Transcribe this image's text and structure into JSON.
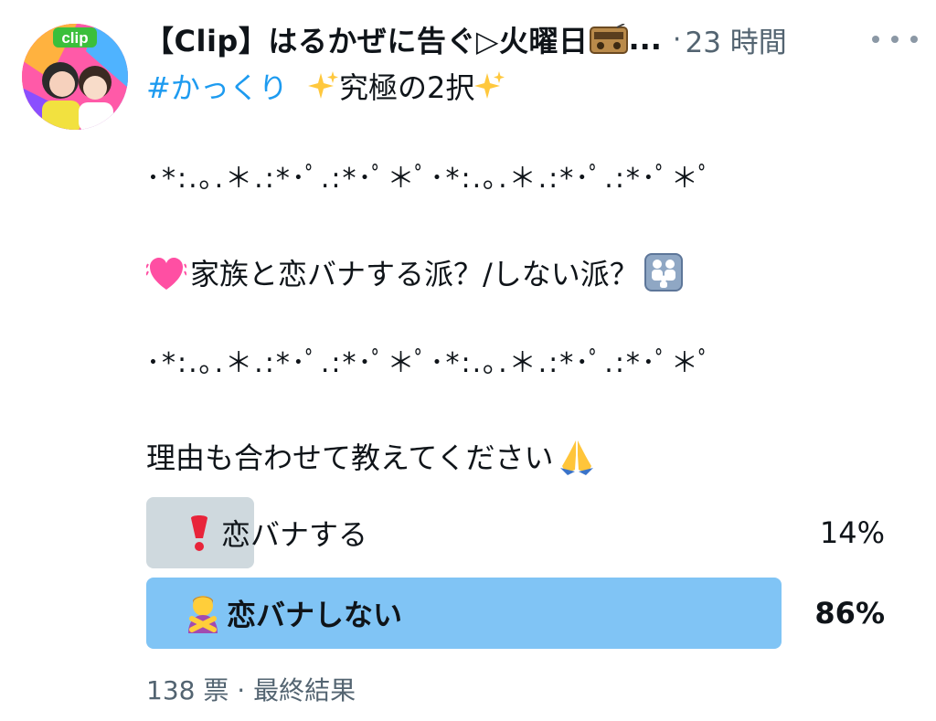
{
  "header": {
    "display_name": "【Clip】はるかぜに告ぐ▷火曜日",
    "radio_icon": "radio-icon",
    "ellipsis": "...",
    "separator": "·",
    "time": "23 時間",
    "more_icon": "more-icon"
  },
  "avatar": {
    "badge": "clip"
  },
  "body": {
    "hashtag": "#かっくり",
    "line1_text": "究極の2択",
    "divider1": "･*:.｡.＊.:*･ﾟ.:*･ﾟ＊ﾟ･*:.｡.＊.:*･ﾟ.:*･ﾟ＊ﾟ",
    "question": "家族と恋バナする派？/しない派？",
    "divider2": "･*:.｡.＊.:*･ﾟ.:*･ﾟ＊ﾟ･*:.｡.＊.:*･ﾟ.:*･ﾟ＊ﾟ",
    "request": "理由も合わせて教えてください"
  },
  "poll": {
    "options": [
      {
        "label": "恋バナする",
        "percent_text": "14%",
        "percent": 14,
        "winner": false,
        "icon": "exclamation-icon"
      },
      {
        "label": "恋バナしない",
        "percent_text": "86%",
        "percent": 86,
        "winner": true,
        "icon": "no-gesture-icon"
      }
    ],
    "votes": "138 票",
    "separator": "·",
    "status": "最終結果"
  },
  "colors": {
    "accent": "#1d9bf0",
    "winner_bar": "#80c4f5",
    "loser_bar": "#cfd9de",
    "secondary_text": "#536471"
  }
}
